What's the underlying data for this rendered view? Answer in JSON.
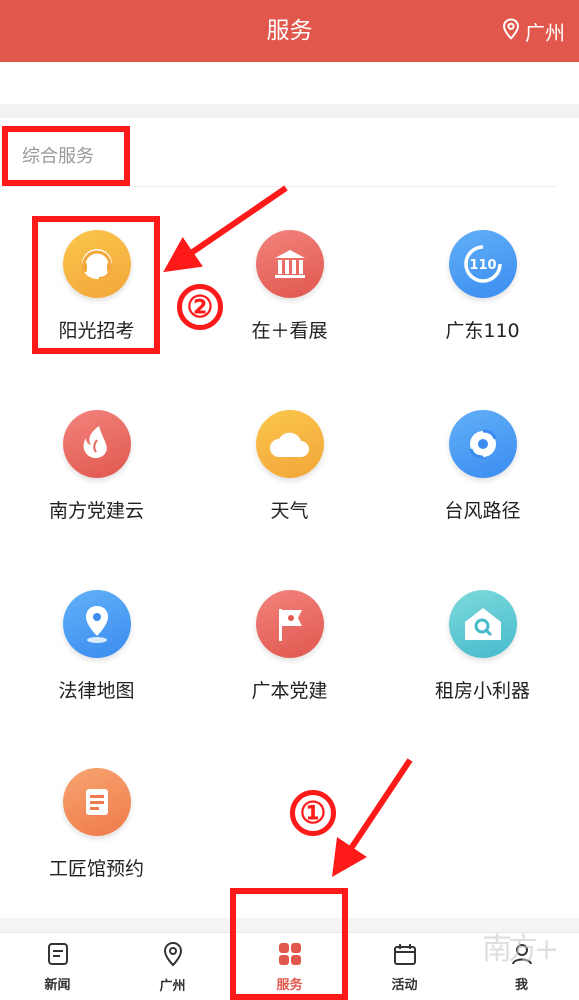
{
  "header": {
    "title": "服务",
    "city": "广州"
  },
  "section": {
    "title": "综合服务"
  },
  "services": [
    {
      "label": "阳光招考",
      "icon": "headset-icon"
    },
    {
      "label": "在＋看展",
      "icon": "museum-icon"
    },
    {
      "label": "广东110",
      "icon": "police-110-icon"
    },
    {
      "label": "南方党建云",
      "icon": "flame-icon"
    },
    {
      "label": "天气",
      "icon": "cloud-icon"
    },
    {
      "label": "台风路径",
      "icon": "typhoon-icon"
    },
    {
      "label": "法律地图",
      "icon": "map-pin-icon"
    },
    {
      "label": "广本党建",
      "icon": "party-flag-icon"
    },
    {
      "label": "租房小利器",
      "icon": "house-search-icon"
    },
    {
      "label": "工匠馆预约",
      "icon": "document-icon"
    }
  ],
  "tabbar": {
    "items": [
      {
        "label": "新闻",
        "icon": "news-icon"
      },
      {
        "label": "广州",
        "icon": "location-icon"
      },
      {
        "label": "服务",
        "icon": "grid-icon"
      },
      {
        "label": "活动",
        "icon": "calendar-icon"
      },
      {
        "label": "我",
        "icon": "user-icon"
      }
    ],
    "active": "服务"
  },
  "annotations": {
    "step1": "①",
    "step2": "②"
  },
  "watermark": "南方+",
  "colors": {
    "header": "#e2574c",
    "annotation": "#ff1a1a",
    "active_tab": "#e2574c"
  }
}
